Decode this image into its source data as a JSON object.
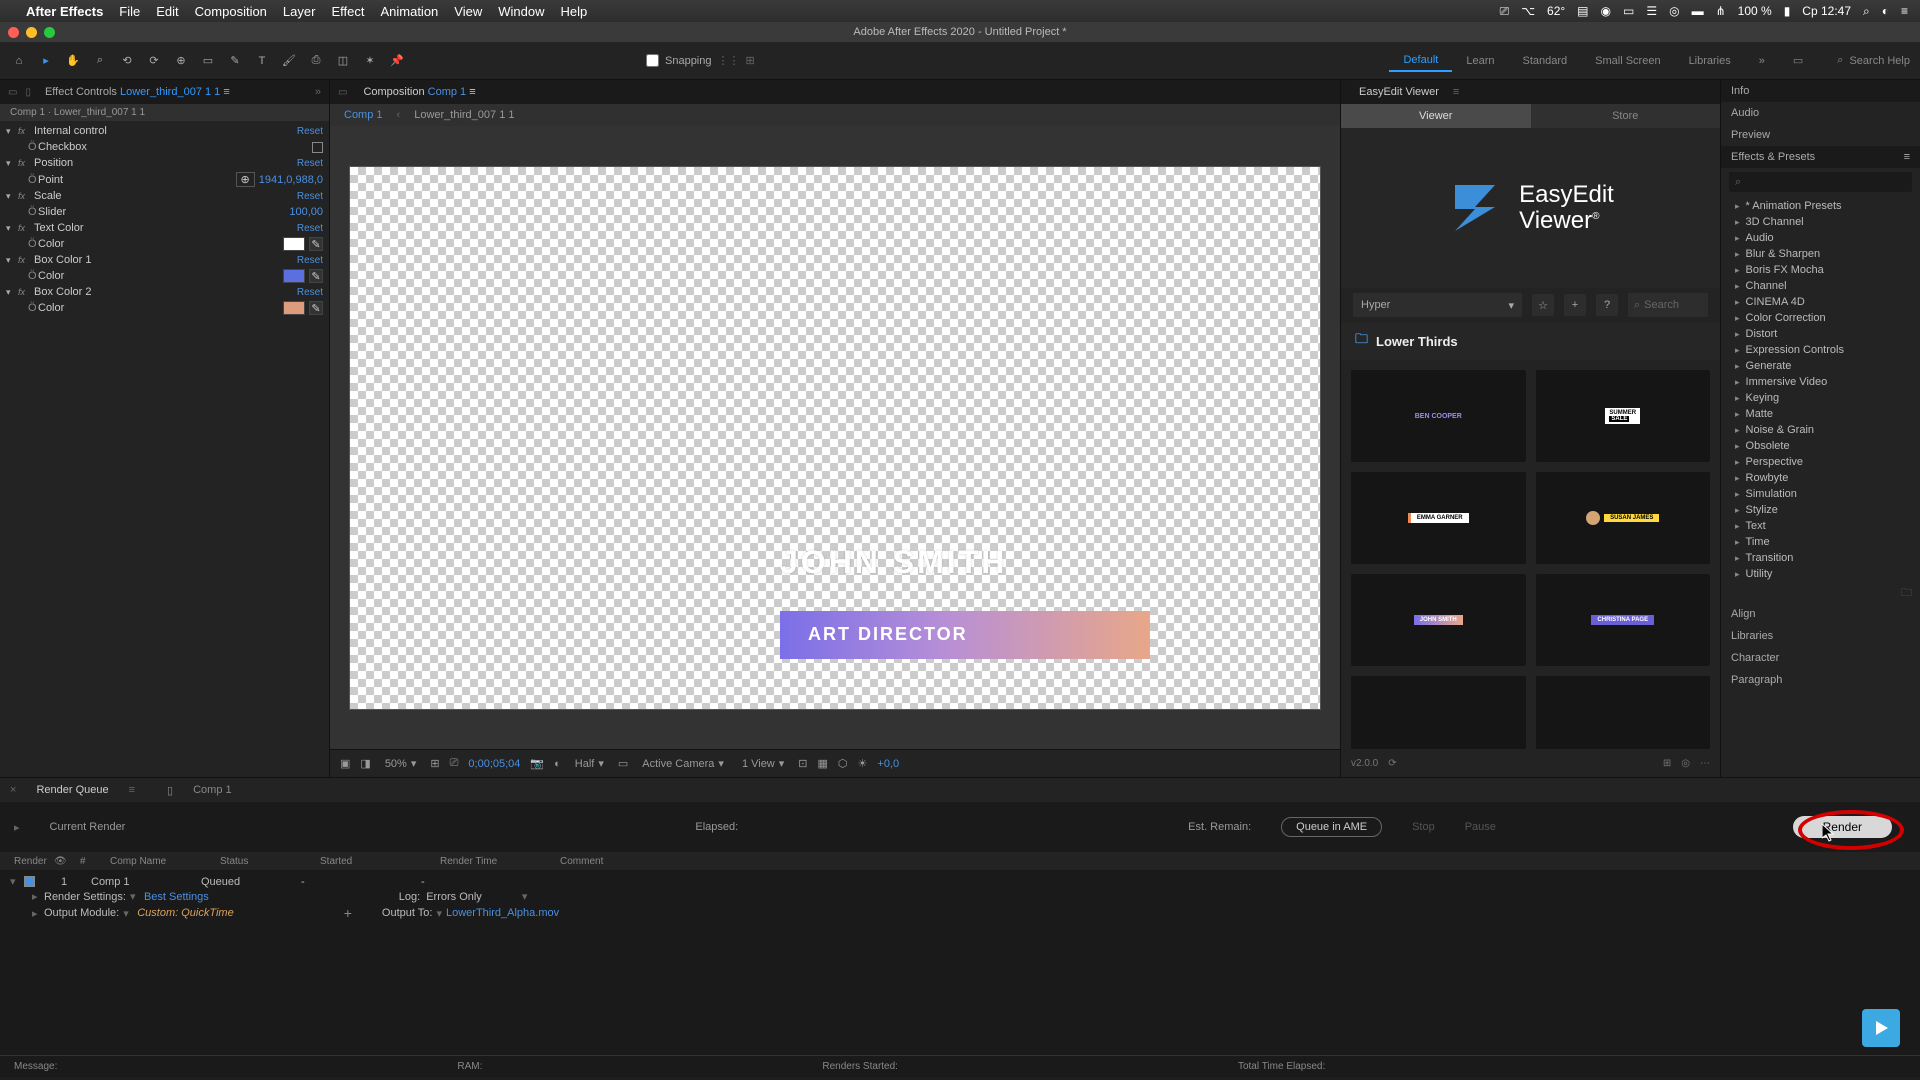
{
  "mac_menu": {
    "app_name": "After Effects",
    "items": [
      "File",
      "Edit",
      "Composition",
      "Layer",
      "Effect",
      "Animation",
      "View",
      "Window",
      "Help"
    ],
    "right": {
      "temp": "62°",
      "battery": "100 %",
      "time": "Ср 12:47"
    }
  },
  "window_title": "Adobe After Effects 2020 - Untitled Project *",
  "toolbar": {
    "snapping_label": "Snapping",
    "workspaces": [
      "Default",
      "Learn",
      "Standard",
      "Small Screen",
      "Libraries"
    ],
    "search_help": "Search Help"
  },
  "effect_controls": {
    "tab_prefix": "Effect Controls",
    "layer_name": "Lower_third_007 1 1",
    "layer_path": "Comp 1 · Lower_third_007 1 1",
    "effects": [
      {
        "name": "Internal control",
        "reset": "Reset",
        "sub": {
          "name": "Checkbox",
          "type": "check"
        }
      },
      {
        "name": "Position",
        "reset": "Reset",
        "sub": {
          "name": "Point",
          "type": "point",
          "value": "1941,0,988,0"
        }
      },
      {
        "name": "Scale",
        "reset": "Reset",
        "sub": {
          "name": "Slider",
          "type": "num",
          "value": "100,00"
        }
      },
      {
        "name": "Text Color",
        "reset": "Reset",
        "sub": {
          "name": "Color",
          "type": "color",
          "swatch": "#ffffff"
        }
      },
      {
        "name": "Box Color 1",
        "reset": "Reset",
        "sub": {
          "name": "Color",
          "type": "color",
          "swatch": "#5b6fe0"
        }
      },
      {
        "name": "Box Color 2",
        "reset": "Reset",
        "sub": {
          "name": "Color",
          "type": "color",
          "swatch": "#dd9d7d"
        }
      }
    ]
  },
  "comp_panel": {
    "tab_prefix": "Composition",
    "active_comp": "Comp 1",
    "crumb1": "Comp 1",
    "crumb2": "Lower_third_007 1 1",
    "lower_third": {
      "name_text": "JOHN SMITH",
      "role_text": "ART DIRECTOR"
    },
    "footer": {
      "zoom": "50%",
      "timecode": "0;00;05;04",
      "res": "Half",
      "camera": "Active Camera",
      "view": "1 View",
      "exposure": "+0,0"
    }
  },
  "easyedit": {
    "tab": "EasyEdit Viewer",
    "subtabs": [
      "Viewer",
      "Store"
    ],
    "brand": {
      "line1": "EasyEdit",
      "line2": "Viewer"
    },
    "dropdown": "Hyper",
    "search_placeholder": "Search",
    "category": "Lower Thirds",
    "thumbs": [
      {
        "label": "BEN COOPER"
      },
      {
        "label": "SUMMER SALE"
      },
      {
        "label": "EMMA GARNER"
      },
      {
        "label": "SUSAN JAMES"
      },
      {
        "label": "JOHN SMITH"
      },
      {
        "label": "CHRISTINA PAGE"
      },
      {
        "label": ""
      },
      {
        "label": ""
      }
    ],
    "version": "v2.0.0"
  },
  "right_panels": {
    "top": [
      "Info",
      "Audio",
      "Preview"
    ],
    "effects_presets": "Effects & Presets",
    "ep_items": [
      "* Animation Presets",
      "3D Channel",
      "Audio",
      "Blur & Sharpen",
      "Boris FX Mocha",
      "Channel",
      "CINEMA 4D",
      "Color Correction",
      "Distort",
      "Expression Controls",
      "Generate",
      "Immersive Video",
      "Keying",
      "Matte",
      "Noise & Grain",
      "Obsolete",
      "Perspective",
      "Rowbyte",
      "Simulation",
      "Stylize",
      "Text",
      "Time",
      "Transition",
      "Utility"
    ],
    "bottom": [
      "Align",
      "Libraries",
      "Character",
      "Paragraph"
    ]
  },
  "render_queue": {
    "tabs": {
      "active": "Render Queue",
      "inactive": "Comp 1"
    },
    "progress": {
      "current": "Current Render",
      "elapsed": "Elapsed:",
      "remain": "Est. Remain:",
      "queue_ame": "Queue in AME",
      "stop": "Stop",
      "pause": "Pause",
      "render": "Render"
    },
    "columns": [
      "Render",
      "",
      "#",
      "Comp Name",
      "Status",
      "Started",
      "Render Time",
      "Comment"
    ],
    "item": {
      "num": "1",
      "comp": "Comp 1",
      "status": "Queued",
      "started": "-",
      "time": "-",
      "render_settings_label": "Render Settings:",
      "render_settings_value": "Best Settings",
      "output_module_label": "Output Module:",
      "output_module_value": "Custom: QuickTime",
      "log_label": "Log:",
      "log_value": "Errors Only",
      "output_to_label": "Output To:",
      "output_to_value": "LowerThird_Alpha.mov"
    },
    "footer": {
      "message": "Message:",
      "ram": "RAM:",
      "renders_started": "Renders Started:",
      "total_time": "Total Time Elapsed:"
    }
  }
}
